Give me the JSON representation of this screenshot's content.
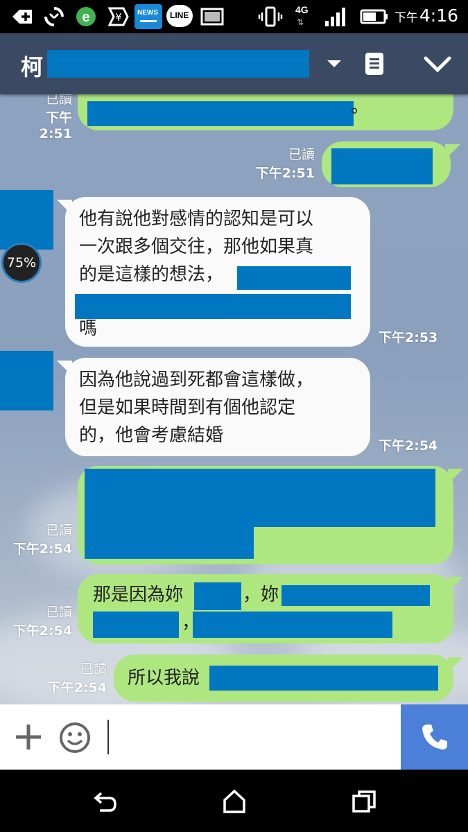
{
  "status_bar": {
    "icons": [
      "add-icon",
      "sync-icon",
      "browser-icon",
      "yuan-icon",
      "news-icon",
      "line-icon",
      "image-icon",
      "vibrate-icon",
      "4g-icon",
      "signal-icon",
      "battery-icon"
    ],
    "news_label": "NEWS",
    "line_label": "LINE",
    "network_label": "4G",
    "ampm": "下午",
    "time": "4:16"
  },
  "header": {
    "title_prefix": "柯",
    "icons": [
      "dropdown-icon",
      "notes-icon",
      "chevron-down-icon"
    ]
  },
  "messages": [
    {
      "id": "m1",
      "direction": "out",
      "read": "已讀",
      "time": "下午2:51",
      "text": "。"
    },
    {
      "id": "m2",
      "direction": "out",
      "read": "已讀",
      "time": "下午2:51",
      "text": ""
    },
    {
      "id": "m3",
      "direction": "in",
      "time": "下午2:53",
      "lines": [
        "他有說他對感情的認知是可以",
        "一次跟多個交往，那他如果真",
        "的是這樣的想法，",
        "",
        "嗎"
      ]
    },
    {
      "id": "m4",
      "direction": "in",
      "time": "下午2:54",
      "lines": [
        "因為他說過到死都會這樣做，",
        "但是如果時間到有個他認定",
        "的，他會考慮結婚"
      ]
    },
    {
      "id": "m5",
      "direction": "out",
      "read": "已讀",
      "time": "下午2:54",
      "text": ""
    },
    {
      "id": "m6",
      "direction": "out",
      "read": "已讀",
      "time": "下午2:54",
      "parts": [
        "那是因為妳",
        "，妳",
        "，"
      ]
    },
    {
      "id": "m7",
      "direction": "out",
      "read": "已讀",
      "time": "下午2:54",
      "text": "所以我說"
    }
  ],
  "avatar_badge": "75%",
  "input_bar": {
    "icons": [
      "plus-icon",
      "emoji-icon",
      "phone-icon"
    ]
  },
  "nav_bar": {
    "icons": [
      "back-icon",
      "home-icon",
      "recents-icon"
    ]
  },
  "colors": {
    "header_bg": "#3b4a63",
    "outgoing_bubble": "#aee680",
    "incoming_bubble": "#fafafa",
    "redaction": "#0077c0",
    "call_button": "#4c80d8"
  }
}
